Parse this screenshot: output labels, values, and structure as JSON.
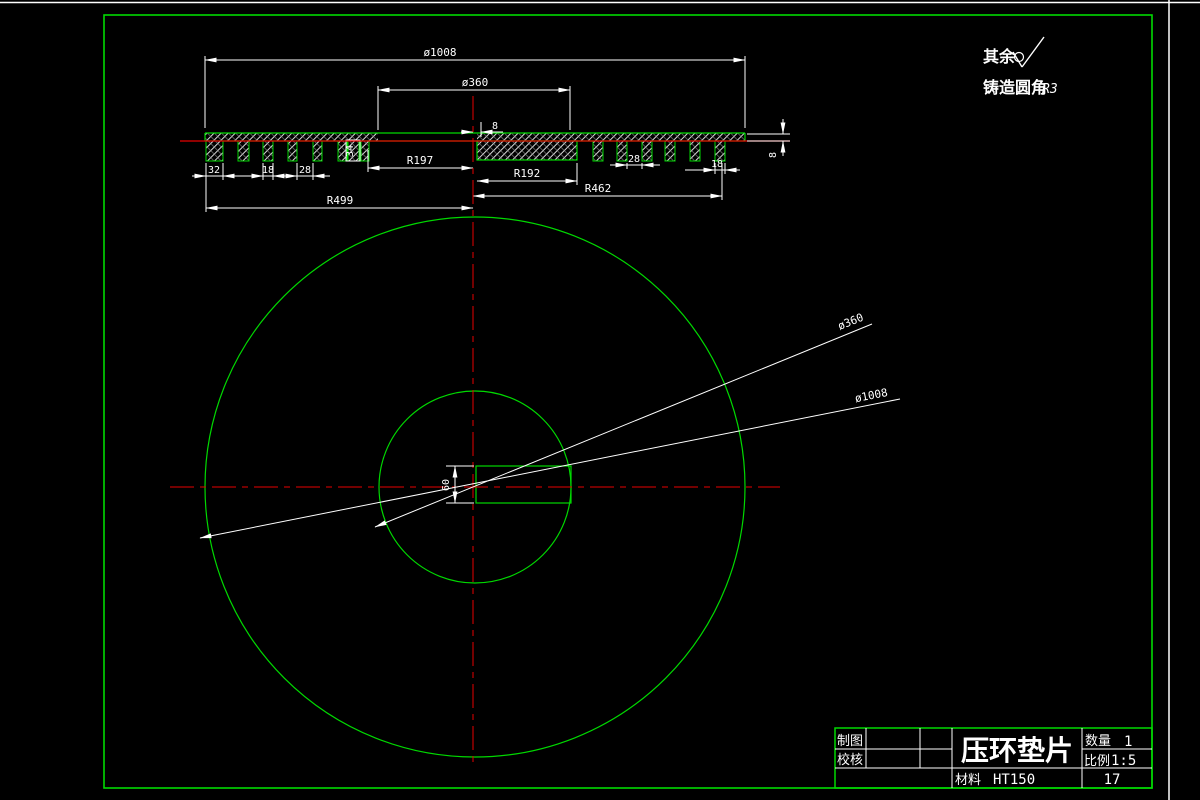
{
  "notes": {
    "rest_label": "其余",
    "cast_label": "铸造圆角",
    "cast_value": "R3"
  },
  "section_dims": {
    "dia_outer": "ø1008",
    "dia_inner": "ø360",
    "offset_center": "8",
    "r197": "R197",
    "r192": "R192",
    "r462": "R462",
    "r499": "R499",
    "w32": "32",
    "w18_left": "18",
    "w28_left": "28",
    "w28_right": "28",
    "w18_right": "18",
    "thk8_right": "8",
    "depth34": "34"
  },
  "plan_labels": {
    "slot_height": "60",
    "leader_dia360": "ø360",
    "leader_dia1008": "ø1008"
  },
  "title_block": {
    "drawn_label": "制图",
    "checked_label": "校核",
    "part_title": "压环垫片",
    "qty_label": "数量",
    "qty_value": "1",
    "scale_label": "比例",
    "scale_value": "1:5",
    "material_label": "材料",
    "material_value": "HT150",
    "sheet_value": "17"
  },
  "colors": {
    "drawing_green": "#00d900",
    "center_red": "#e60000",
    "dim_white": "#ffffff",
    "note_green": "#00e045",
    "background": "#000000"
  }
}
